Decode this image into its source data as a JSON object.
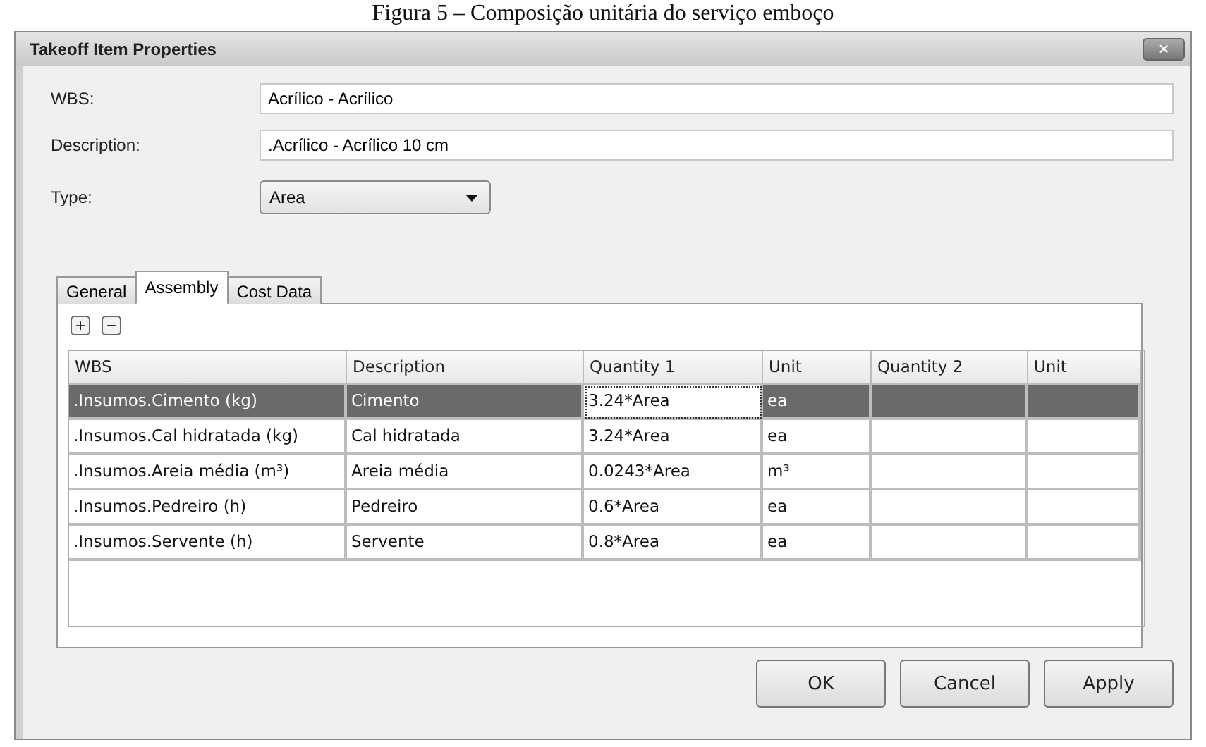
{
  "caption": "Figura 5 – Composição unitária do serviço emboço",
  "window": {
    "title": "Takeoff Item Properties",
    "close": "×"
  },
  "fields": [
    {
      "label": "WBS:",
      "value": "Acrílico - Acrílico",
      "kind": "text"
    },
    {
      "label": "Description:",
      "value": ".Acrílico - Acrílico 10 cm",
      "kind": "text"
    },
    {
      "label": "Type:",
      "value": "Area",
      "kind": "dropdown"
    }
  ],
  "tabs": [
    {
      "label": "General",
      "selected": false
    },
    {
      "label": "Assembly",
      "selected": true
    },
    {
      "label": "Cost Data",
      "selected": false
    }
  ],
  "toolbar": [
    {
      "symbol": "+"
    },
    {
      "symbol": "−"
    }
  ],
  "table": {
    "columns": [
      "WBS",
      "Description",
      "Quantity 1",
      "Unit",
      "Quantity 2",
      "Unit"
    ],
    "rows": [
      {
        "selected": true,
        "cells": [
          {
            "text": ".Insumos.Cimento (kg)",
            "focused": false
          },
          {
            "text": "Cimento",
            "focused": false
          },
          {
            "text": "3.24*Area",
            "focused": true
          },
          {
            "text": "ea",
            "focused": false
          }
        ]
      },
      {
        "selected": false,
        "cells": [
          {
            "text": ".Insumos.Cal hidratada (kg)",
            "focused": false
          },
          {
            "text": "Cal hidratada",
            "focused": false
          },
          {
            "text": "3.24*Area",
            "focused": false
          },
          {
            "text": "ea",
            "focused": false
          }
        ]
      },
      {
        "selected": false,
        "cells": [
          {
            "text": ".Insumos.Areia média (m³)",
            "focused": false
          },
          {
            "text": "Areia média",
            "focused": false
          },
          {
            "text": "0.0243*Area",
            "focused": false
          },
          {
            "text": "m³",
            "focused": false
          }
        ]
      },
      {
        "selected": false,
        "cells": [
          {
            "text": ".Insumos.Pedreiro (h)",
            "focused": false
          },
          {
            "text": "Pedreiro",
            "focused": false
          },
          {
            "text": "0.6*Area",
            "focused": false
          },
          {
            "text": "ea",
            "focused": false
          }
        ]
      },
      {
        "selected": false,
        "cells": [
          {
            "text": ".Insumos.Servente (h)",
            "focused": false
          },
          {
            "text": "Servente",
            "focused": false
          },
          {
            "text": "0.8*Area",
            "focused": false
          },
          {
            "text": "ea",
            "focused": false
          }
        ]
      }
    ]
  },
  "buttons": [
    "OK",
    "Cancel",
    "Apply"
  ]
}
